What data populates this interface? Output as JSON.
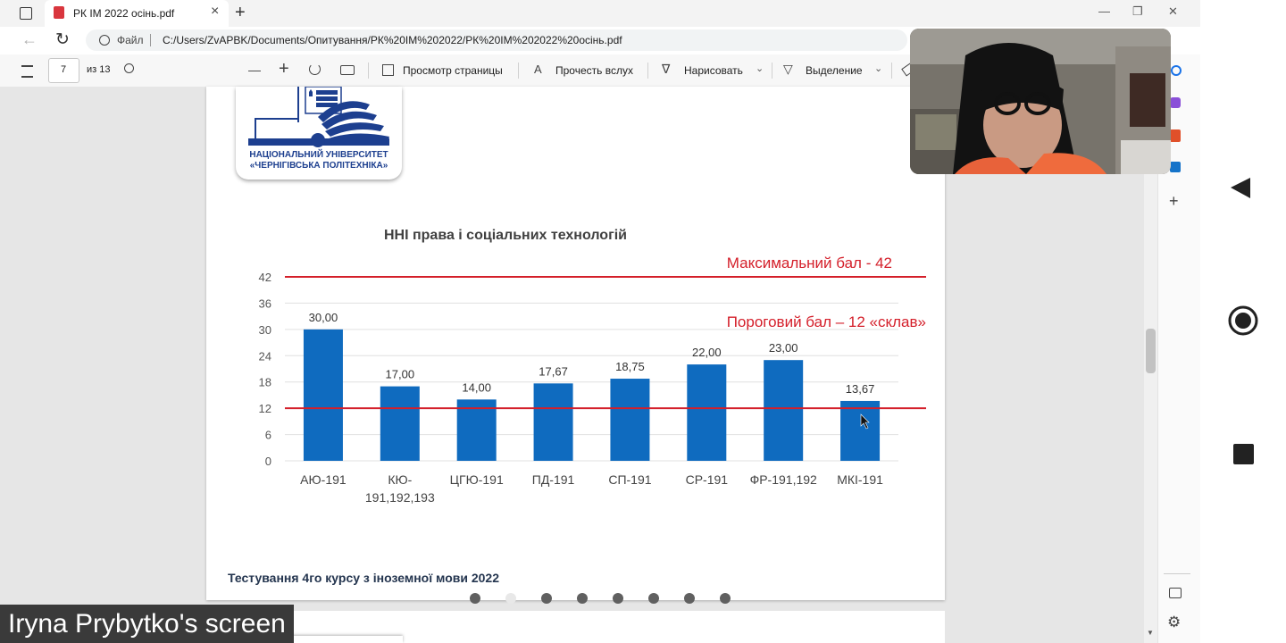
{
  "browser": {
    "tab_title": "РК ІМ 2022 осінь.pdf",
    "tab_close": "×",
    "new_tab": "+",
    "window_controls": [
      "—",
      "❐",
      "✕"
    ],
    "back": "←",
    "reload": "↻",
    "info_label": "Файл",
    "url": "C:/Users/ZvAPBK/Documents/Опитування/РК%20ІМ%202022/РК%20ІМ%202022%20осінь.pdf"
  },
  "pdf_toolbar": {
    "page_number": "7",
    "page_total": "из 13",
    "zoom_out": "—",
    "zoom_in": "+",
    "page_view": "Просмотр страницы",
    "read_aloud": "Прочесть вслух",
    "draw": "Нарисовать",
    "highlight": "Выделение"
  },
  "logo": {
    "line1": "НАЦІОНАЛЬНИЙ УНІВЕРСИТЕТ",
    "line2": "«ЧЕРНІГІВСЬКА ПОЛІТЕХНІКА»"
  },
  "chart_data": {
    "type": "bar",
    "title": "ННІ права і соціальних технологій",
    "categories": [
      "АЮ-191",
      "КЮ-191,192,193",
      "ЦГЮ-191",
      "ПД-191",
      "СП-191",
      "СР-191",
      "ФР-191,192",
      "МКІ-191"
    ],
    "category_lines": [
      [
        "АЮ-191"
      ],
      [
        "КЮ-",
        "191,192,193"
      ],
      [
        "ЦГЮ-191"
      ],
      [
        "ПД-191"
      ],
      [
        "СП-191"
      ],
      [
        "СР-191"
      ],
      [
        "ФР-191,192"
      ],
      [
        "МКІ-191"
      ]
    ],
    "values": [
      30.0,
      17.0,
      14.0,
      17.67,
      18.75,
      22.0,
      23.0,
      13.67
    ],
    "value_labels": [
      "30,00",
      "17,00",
      "14,00",
      "17,67",
      "18,75",
      "22,00",
      "23,00",
      "13,67"
    ],
    "y_ticks": [
      0,
      6,
      12,
      18,
      24,
      30,
      36,
      42
    ],
    "ylim": [
      0,
      42
    ],
    "grid": true,
    "bar_color": "#0f6bbf",
    "reference_lines": [
      {
        "value": 42,
        "label": "Максимальний бал - 42",
        "color": "#d41f2a"
      },
      {
        "value": 12,
        "label": "Пороговий бал – 12 «склав»",
        "color": "#d41f2a"
      }
    ]
  },
  "footer_text": "Тестування 4го курсу з іноземної мови 2022",
  "pager": {
    "count": 8,
    "active": 1
  },
  "screen_share_caption": "Iryna Prybytko's screen",
  "colors": {
    "accent_red": "#d41f2a",
    "bar_blue": "#0f6bbf",
    "logo_blue": "#1d3f8f"
  }
}
